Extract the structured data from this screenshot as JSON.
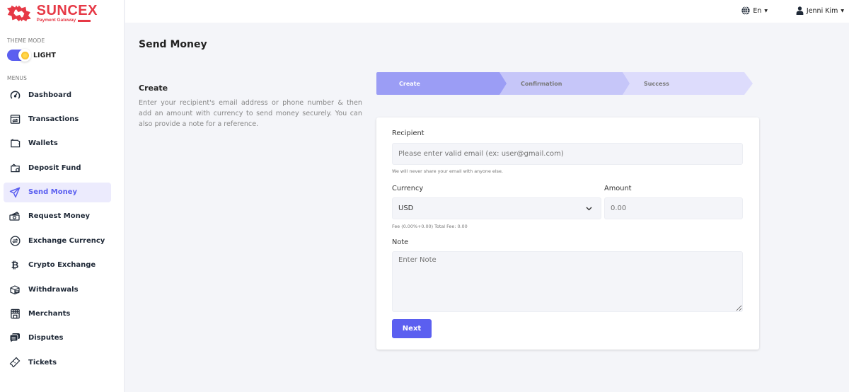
{
  "brand": {
    "name": "SUNCEX",
    "tagline": "Payment Gateway",
    "color": "#e63946"
  },
  "sidebar": {
    "theme_mode_label": "THEME MODE",
    "theme_value": "LIGHT",
    "menus_label": "MENUS",
    "items": [
      {
        "label": "Dashboard",
        "icon": "dashboard-gauge-icon",
        "active": false
      },
      {
        "label": "Transactions",
        "icon": "transactions-icon",
        "active": false
      },
      {
        "label": "Wallets",
        "icon": "wallet-icon",
        "active": false
      },
      {
        "label": "Deposit Fund",
        "icon": "deposit-wallet-icon",
        "active": false
      },
      {
        "label": "Send Money",
        "icon": "paper-plane-icon",
        "active": true
      },
      {
        "label": "Request Money",
        "icon": "money-request-icon",
        "active": false
      },
      {
        "label": "Exchange Currency",
        "icon": "exchange-icon",
        "active": false
      },
      {
        "label": "Crypto Exchange",
        "icon": "bitcoin-icon",
        "active": false
      },
      {
        "label": "Withdrawals",
        "icon": "withdraw-box-icon",
        "active": false
      },
      {
        "label": "Merchants",
        "icon": "store-icon",
        "active": false
      },
      {
        "label": "Disputes",
        "icon": "chat-bubbles-icon",
        "active": false
      },
      {
        "label": "Tickets",
        "icon": "ticket-icon",
        "active": false
      }
    ]
  },
  "topbar": {
    "language": "En",
    "user_name": "Jenni Kim"
  },
  "page": {
    "title": "Send Money",
    "intro_title": "Create",
    "intro_text": "Enter your recipient's email address or phone number & then add an amount with currency to send money securely. You can also provide a note for a reference."
  },
  "steps": [
    {
      "label": "Create",
      "state": "active"
    },
    {
      "label": "Confirmation",
      "state": "pending"
    },
    {
      "label": "Success",
      "state": "pending"
    }
  ],
  "form": {
    "recipient_label": "Recipient",
    "recipient_placeholder": "Please enter valid email (ex: user@gmail.com)",
    "recipient_value": "",
    "recipient_help": "We will never share your email with anyone else.",
    "currency_label": "Currency",
    "currency_value": "USD",
    "amount_label": "Amount",
    "amount_placeholder": "0.00",
    "fee_text": "Fee (0.00%+0.00) Total Fee: 0.00",
    "note_label": "Note",
    "note_placeholder": "Enter Note",
    "next_label": "Next"
  },
  "colors": {
    "accent": "#5b5ff0",
    "step_active": "#9b9df5",
    "step_mid": "#c6c6f9",
    "step_last": "#dddcfc",
    "background": "#f4f5f9"
  }
}
